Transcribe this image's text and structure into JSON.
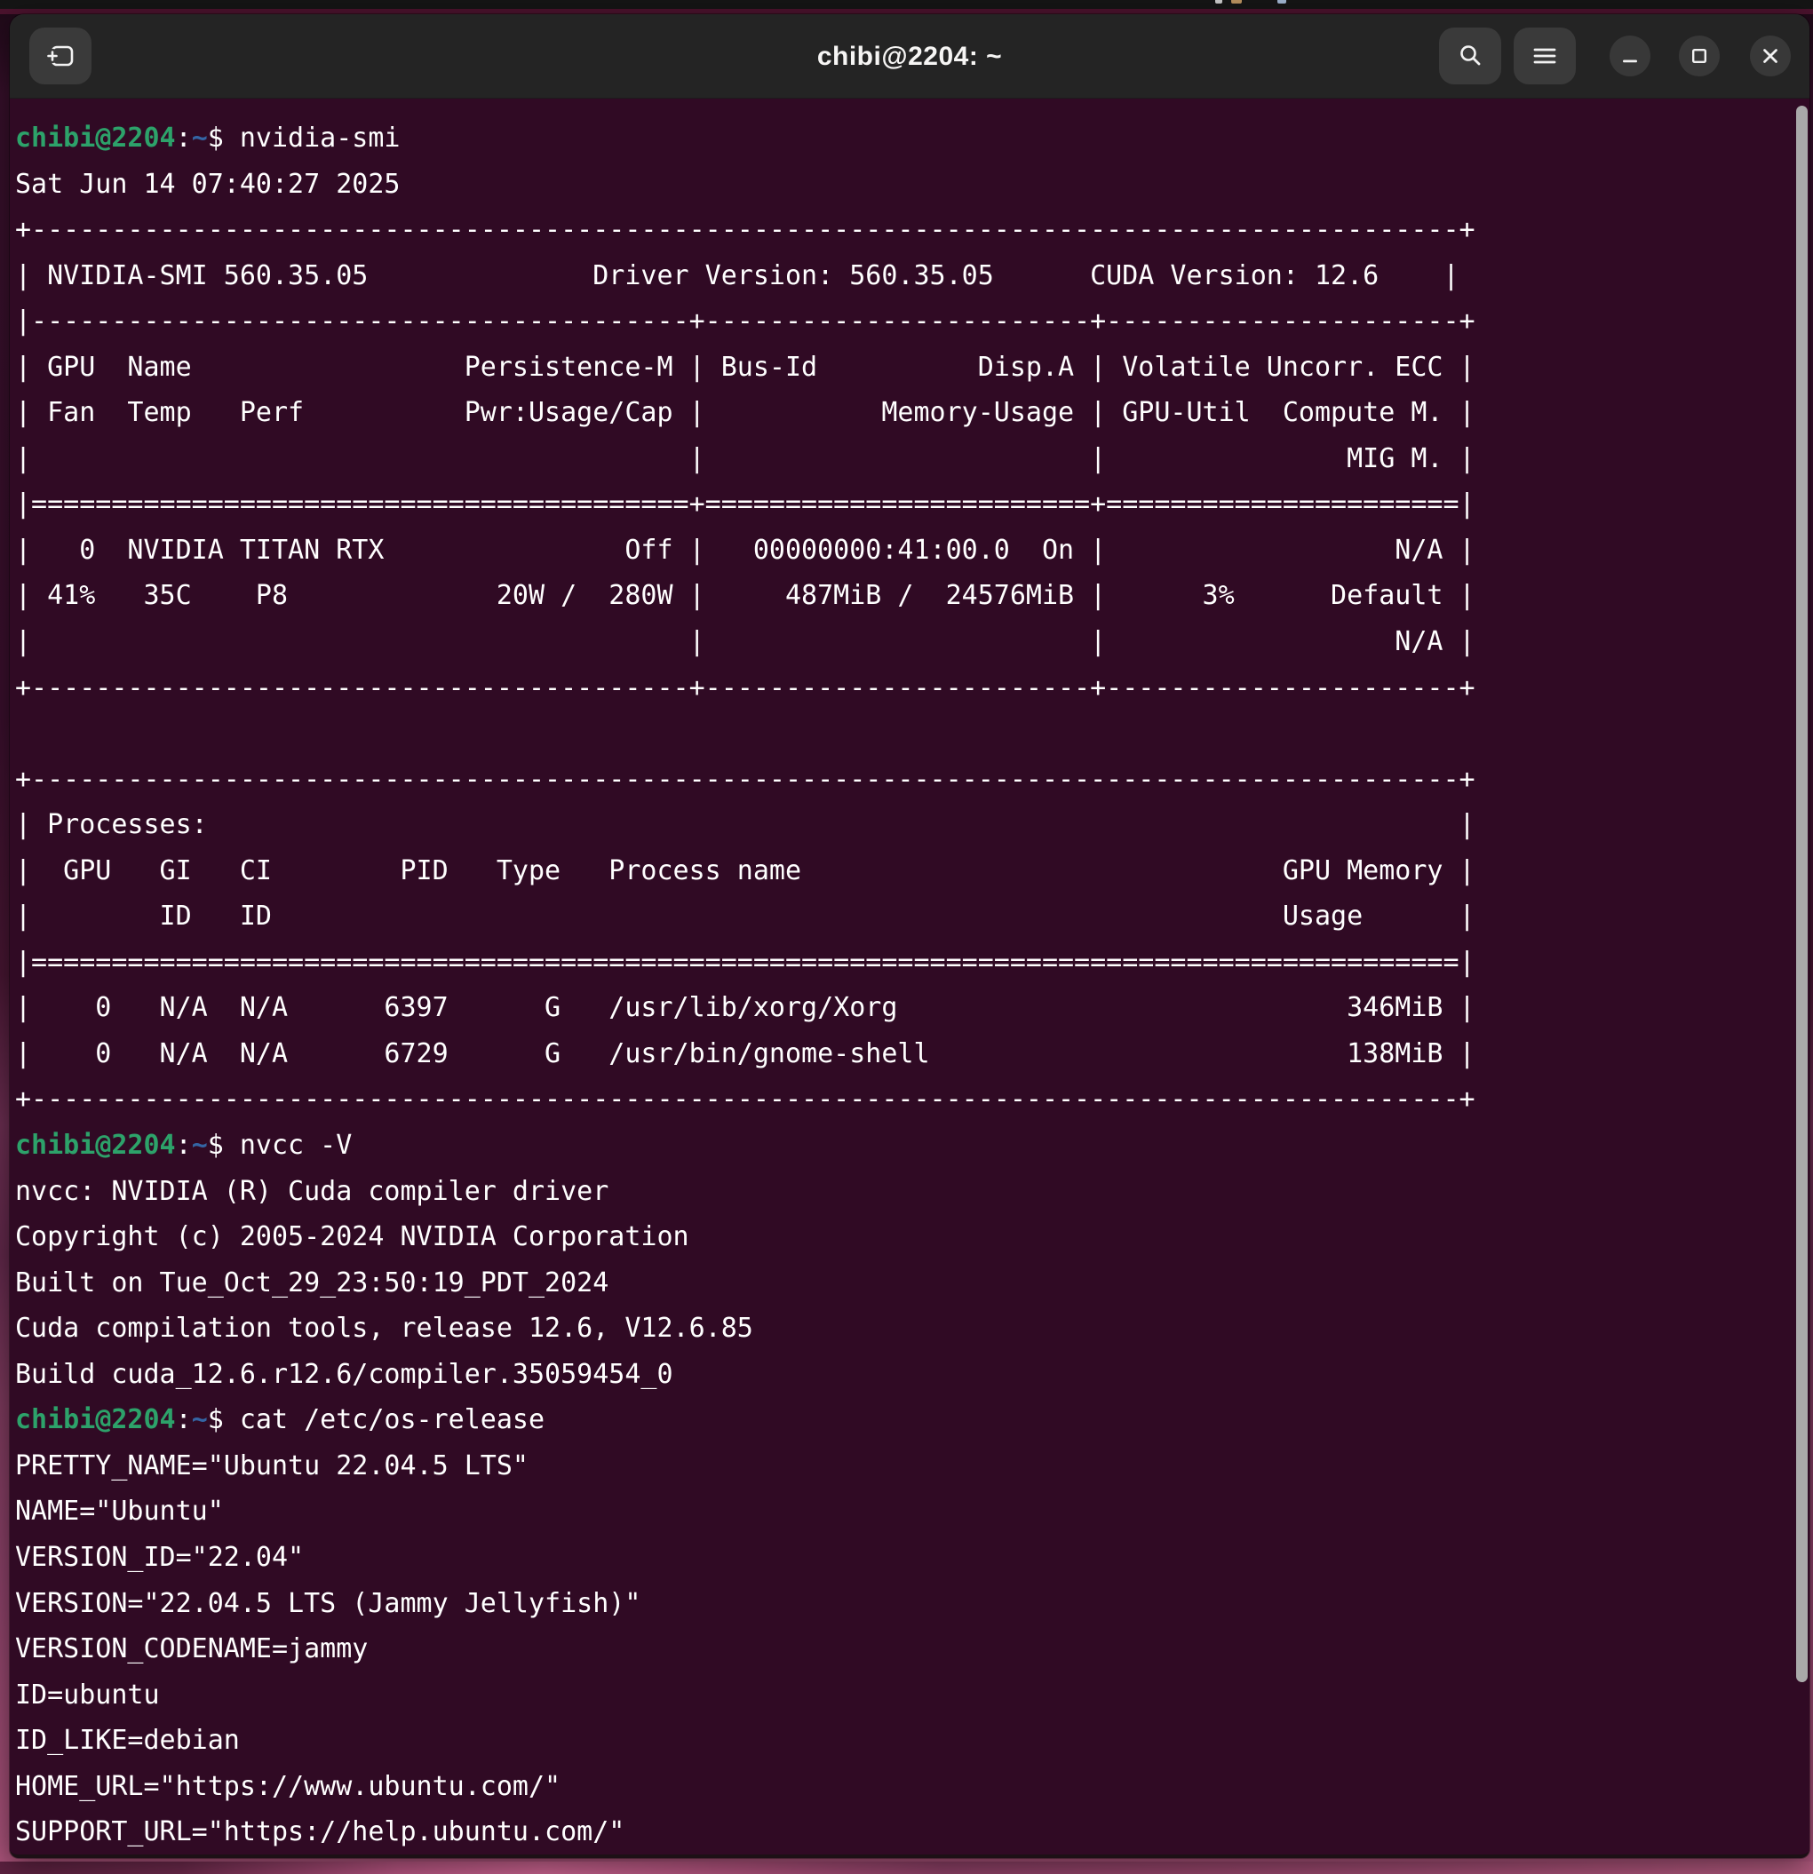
{
  "window": {
    "title": "chibi@2204: ~",
    "controls": {
      "new_tab": "tab-new-icon",
      "search": "search-icon",
      "menu": "menu-icon",
      "minimize": "minimize-icon",
      "maximize": "maximize-icon",
      "close": "close-icon"
    }
  },
  "terminal": {
    "prompt": {
      "user_host": "chibi@2204",
      "separator": ":",
      "path": "~",
      "sigil": "$ "
    },
    "lines": [
      {
        "type": "prompt",
        "command": "nvidia-smi"
      },
      {
        "type": "output",
        "text": "Sat Jun 14 07:40:27 2025"
      },
      {
        "type": "output",
        "text": "+-----------------------------------------------------------------------------------------+"
      },
      {
        "type": "output",
        "text": "| NVIDIA-SMI 560.35.05              Driver Version: 560.35.05      CUDA Version: 12.6    |"
      },
      {
        "type": "output",
        "text": "|-----------------------------------------+------------------------+----------------------+"
      },
      {
        "type": "output",
        "text": "| GPU  Name                 Persistence-M | Bus-Id          Disp.A | Volatile Uncorr. ECC |"
      },
      {
        "type": "output",
        "text": "| Fan  Temp   Perf          Pwr:Usage/Cap |           Memory-Usage | GPU-Util  Compute M. |"
      },
      {
        "type": "output",
        "text": "|                                         |                        |               MIG M. |"
      },
      {
        "type": "output",
        "text": "|=========================================+========================+======================|"
      },
      {
        "type": "output",
        "text": "|   0  NVIDIA TITAN RTX               Off |   00000000:41:00.0  On |                  N/A |"
      },
      {
        "type": "output",
        "text": "| 41%   35C    P8             20W /  280W |     487MiB /  24576MiB |      3%      Default |"
      },
      {
        "type": "output",
        "text": "|                                         |                        |                  N/A |"
      },
      {
        "type": "output",
        "text": "+-----------------------------------------+------------------------+----------------------+"
      },
      {
        "type": "blank"
      },
      {
        "type": "output",
        "text": "+-----------------------------------------------------------------------------------------+"
      },
      {
        "type": "output",
        "text": "| Processes:                                                                              |"
      },
      {
        "type": "output",
        "text": "|  GPU   GI   CI        PID   Type   Process name                              GPU Memory |"
      },
      {
        "type": "output",
        "text": "|        ID   ID                                                               Usage      |"
      },
      {
        "type": "output",
        "text": "|=========================================================================================|"
      },
      {
        "type": "output",
        "text": "|    0   N/A  N/A      6397      G   /usr/lib/xorg/Xorg                            346MiB |"
      },
      {
        "type": "output",
        "text": "|    0   N/A  N/A      6729      G   /usr/bin/gnome-shell                          138MiB |"
      },
      {
        "type": "output",
        "text": "+-----------------------------------------------------------------------------------------+"
      },
      {
        "type": "prompt",
        "command": "nvcc -V"
      },
      {
        "type": "output",
        "text": "nvcc: NVIDIA (R) Cuda compiler driver"
      },
      {
        "type": "output",
        "text": "Copyright (c) 2005-2024 NVIDIA Corporation"
      },
      {
        "type": "output",
        "text": "Built on Tue_Oct_29_23:50:19_PDT_2024"
      },
      {
        "type": "output",
        "text": "Cuda compilation tools, release 12.6, V12.6.85"
      },
      {
        "type": "output",
        "text": "Build cuda_12.6.r12.6/compiler.35059454_0"
      },
      {
        "type": "prompt",
        "command": "cat /etc/os-release"
      },
      {
        "type": "output",
        "text": "PRETTY_NAME=\"Ubuntu 22.04.5 LTS\""
      },
      {
        "type": "output",
        "text": "NAME=\"Ubuntu\""
      },
      {
        "type": "output",
        "text": "VERSION_ID=\"22.04\""
      },
      {
        "type": "output",
        "text": "VERSION=\"22.04.5 LTS (Jammy Jellyfish)\""
      },
      {
        "type": "output",
        "text": "VERSION_CODENAME=jammy"
      },
      {
        "type": "output",
        "text": "ID=ubuntu"
      },
      {
        "type": "output",
        "text": "ID_LIKE=debian"
      },
      {
        "type": "output",
        "text": "HOME_URL=\"https://www.ubuntu.com/\""
      },
      {
        "type": "output",
        "text": "SUPPORT_URL=\"https://help.ubuntu.com/\""
      }
    ]
  },
  "colors": {
    "term_bg": "#300a24",
    "titlebar_bg": "#242424",
    "button_bg": "#3a3a3a",
    "circle_bg": "#383838",
    "fg": "#ffffff",
    "green": "#2da26a",
    "blue": "#3465a4",
    "scrollbar": "#a9a9a9"
  }
}
